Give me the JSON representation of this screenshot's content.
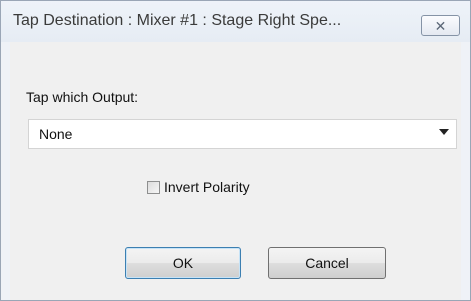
{
  "window": {
    "title": "Tap Destination : Mixer #1 : Stage Right Spe...",
    "close_icon": "close-icon"
  },
  "form": {
    "output_label": "Tap which Output:",
    "output_select": {
      "selected": "None"
    },
    "invert_polarity": {
      "label": "Invert Polarity",
      "checked": false
    }
  },
  "buttons": {
    "ok_label": "OK",
    "cancel_label": "Cancel"
  }
}
